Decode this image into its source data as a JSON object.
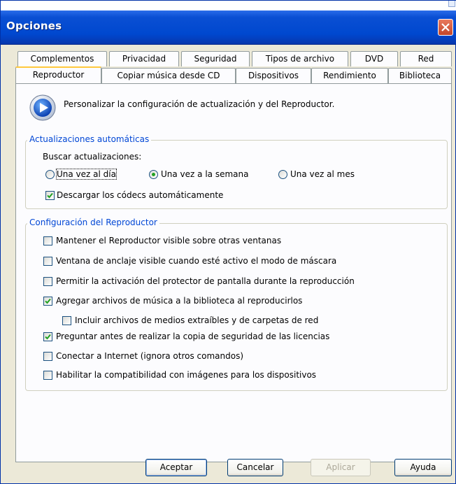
{
  "window": {
    "title": "Opciones"
  },
  "tabs_back": [
    "Complementos",
    "Privacidad",
    "Seguridad",
    "Tipos de archivo",
    "DVD",
    "Red"
  ],
  "tabs_front": [
    "Reproductor",
    "Copiar música desde CD",
    "Dispositivos",
    "Rendimiento",
    "Biblioteca"
  ],
  "active_tab": "Reproductor",
  "header": {
    "text": "Personalizar la configuración de actualización y del Reproductor."
  },
  "updates": {
    "group_title": "Actualizaciones automáticas",
    "check_label": "Buscar actualizaciones:",
    "radios": [
      {
        "label": "Una vez al día",
        "checked": false
      },
      {
        "label": "Una vez a la semana",
        "checked": true
      },
      {
        "label": "Una vez al mes",
        "checked": false
      }
    ],
    "codecs": {
      "label": "Descargar los códecs automáticamente",
      "checked": true
    }
  },
  "player": {
    "group_title": "Configuración del Reproductor",
    "options": [
      {
        "label": "Mantener el Reproductor visible sobre otras ventanas",
        "checked": false
      },
      {
        "label": "Ventana de anclaje visible cuando esté activo el modo de máscara",
        "checked": false
      },
      {
        "label": "Permitir la activación del protector de pantalla durante la reproducción",
        "checked": false
      },
      {
        "label": "Agregar archivos de música a la biblioteca al reproducirlos",
        "checked": true
      },
      {
        "label": "Incluir archivos de medios extraíbles y de carpetas de red",
        "checked": false
      },
      {
        "label": "Preguntar antes de realizar la copia de seguridad de las licencias",
        "checked": true
      },
      {
        "label": "Conectar a Internet (ignora otros comandos)",
        "checked": false
      },
      {
        "label": "Habilitar la compatibilidad con imágenes para los dispositivos",
        "checked": false
      }
    ]
  },
  "buttons": {
    "ok": "Aceptar",
    "cancel": "Cancelar",
    "apply": "Aplicar",
    "help": "Ayuda"
  },
  "colors": {
    "titlebar": "#0a4fd3",
    "group_title": "#0046d5",
    "active_tab_accent": "#ffc83c",
    "close": "#c3462a"
  }
}
